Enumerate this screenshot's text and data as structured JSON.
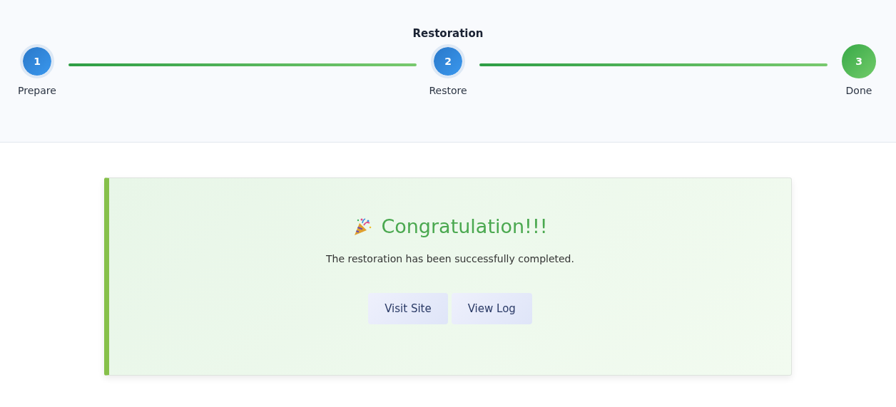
{
  "wizard": {
    "title": "Restoration",
    "steps": [
      {
        "number": "1",
        "label": "Prepare",
        "complete": false
      },
      {
        "number": "2",
        "label": "Restore",
        "complete": false
      },
      {
        "number": "3",
        "label": "Done",
        "complete": true
      }
    ]
  },
  "result": {
    "heading": "Congratulation!!!",
    "message": "The restoration has been successfully completed.",
    "buttons": [
      "Visit Site",
      "View Log"
    ]
  }
}
